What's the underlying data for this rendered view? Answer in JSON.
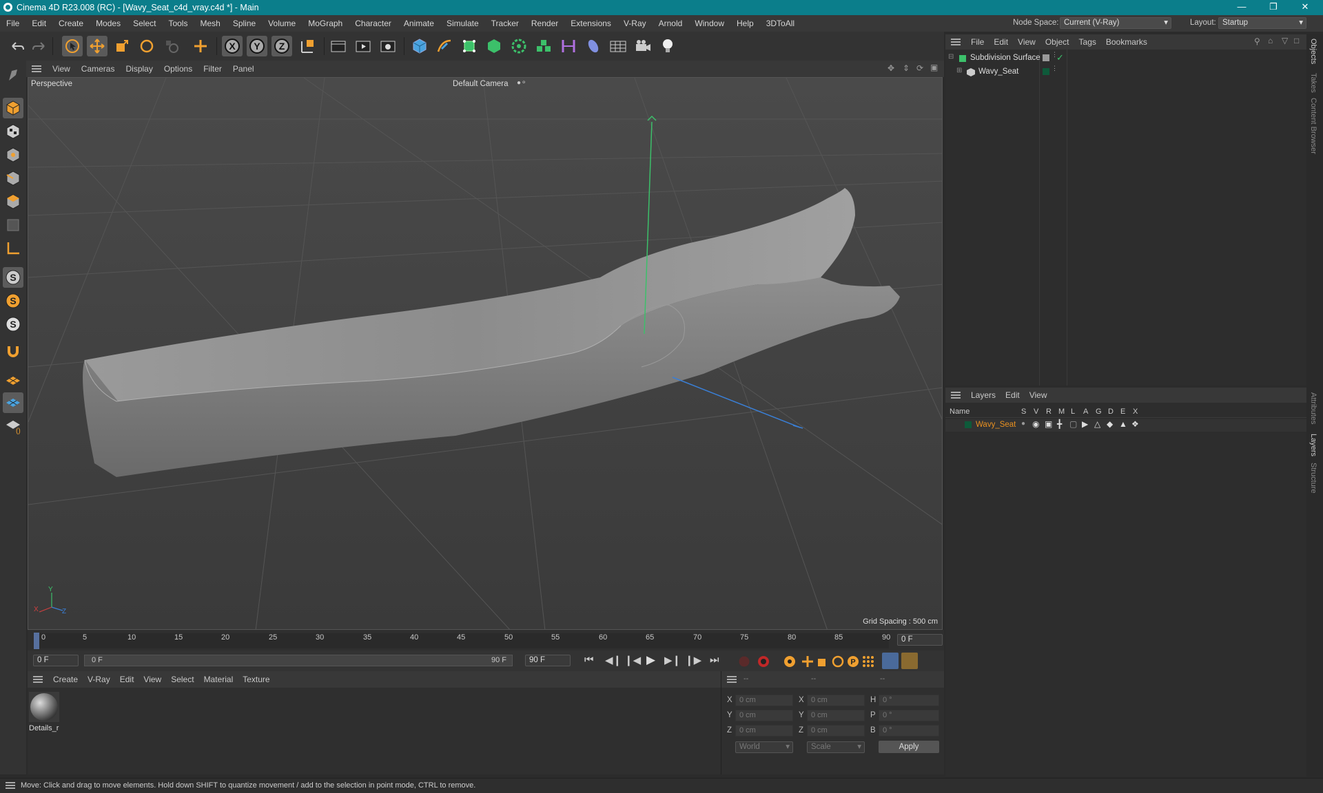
{
  "window": {
    "title": "Cinema 4D R23.008 (RC) - [Wavy_Seat_c4d_vray.c4d *] - Main"
  },
  "menubar": {
    "items": [
      "File",
      "Edit",
      "Create",
      "Modes",
      "Select",
      "Tools",
      "Mesh",
      "Spline",
      "Volume",
      "MoGraph",
      "Character",
      "Animate",
      "Simulate",
      "Tracker",
      "Render",
      "Extensions",
      "V-Ray",
      "Arnold",
      "Window",
      "Help",
      "3DToAll"
    ],
    "node_space_label": "Node Space:",
    "node_space_value": "Current (V-Ray)",
    "layout_label": "Layout:",
    "layout_value": "Startup"
  },
  "viewport": {
    "menu": [
      "View",
      "Cameras",
      "Display",
      "Options",
      "Filter",
      "Panel"
    ],
    "view_name": "Perspective",
    "camera": "Default Camera",
    "grid_spacing": "Grid Spacing : 500 cm",
    "axes": {
      "x": "X",
      "y": "Y",
      "z": "Z"
    }
  },
  "timeline": {
    "ticks": [
      "0",
      "5",
      "10",
      "15",
      "20",
      "25",
      "30",
      "35",
      "40",
      "45",
      "50",
      "55",
      "60",
      "65",
      "70",
      "75",
      "80",
      "85",
      "90"
    ],
    "current_frame": "0 F"
  },
  "transport": {
    "start_field": "0 F",
    "range_start": "0 F",
    "range_end": "90 F",
    "end_field": "90 F"
  },
  "material_manager": {
    "menu": [
      "Create",
      "V-Ray",
      "Edit",
      "View",
      "Select",
      "Material",
      "Texture"
    ],
    "materials": [
      {
        "name": "Details_r"
      }
    ]
  },
  "coordinates": {
    "headers": [
      "--",
      "--",
      "--"
    ],
    "rows": [
      {
        "a": "X",
        "av": "0 cm",
        "b": "X",
        "bv": "0 cm",
        "c": "H",
        "cv": "0 °"
      },
      {
        "a": "Y",
        "av": "0 cm",
        "b": "Y",
        "bv": "0 cm",
        "c": "P",
        "cv": "0 °"
      },
      {
        "a": "Z",
        "av": "0 cm",
        "b": "Z",
        "bv": "0 cm",
        "c": "B",
        "cv": "0 °"
      }
    ],
    "mode1": "World",
    "mode2": "Scale",
    "apply": "Apply"
  },
  "object_manager": {
    "menu": [
      "File",
      "Edit",
      "View",
      "Object",
      "Tags",
      "Bookmarks"
    ],
    "objects": [
      {
        "name": "Subdivision Surface"
      },
      {
        "name": "Wavy_Seat"
      }
    ]
  },
  "layer_manager": {
    "menu": [
      "Layers",
      "Edit",
      "View"
    ],
    "columns": [
      "Name",
      "S",
      "V",
      "R",
      "M",
      "L",
      "A",
      "G",
      "D",
      "E",
      "X"
    ],
    "layers": [
      {
        "name": "Wavy_Seat",
        "color": "#0e5a3a"
      }
    ]
  },
  "right_tabs": [
    "Objects",
    "Takes",
    "Content Browser",
    "Attributes",
    "Layers",
    "Structure"
  ],
  "status": {
    "text": "Move: Click and drag to move elements. Hold down SHIFT to quantize movement / add to the selection in point mode, CTRL to remove."
  },
  "colors": {
    "titlebar": "#0b7e8b",
    "accent_orange": "#f0a030",
    "layer_name": "#e89020"
  }
}
